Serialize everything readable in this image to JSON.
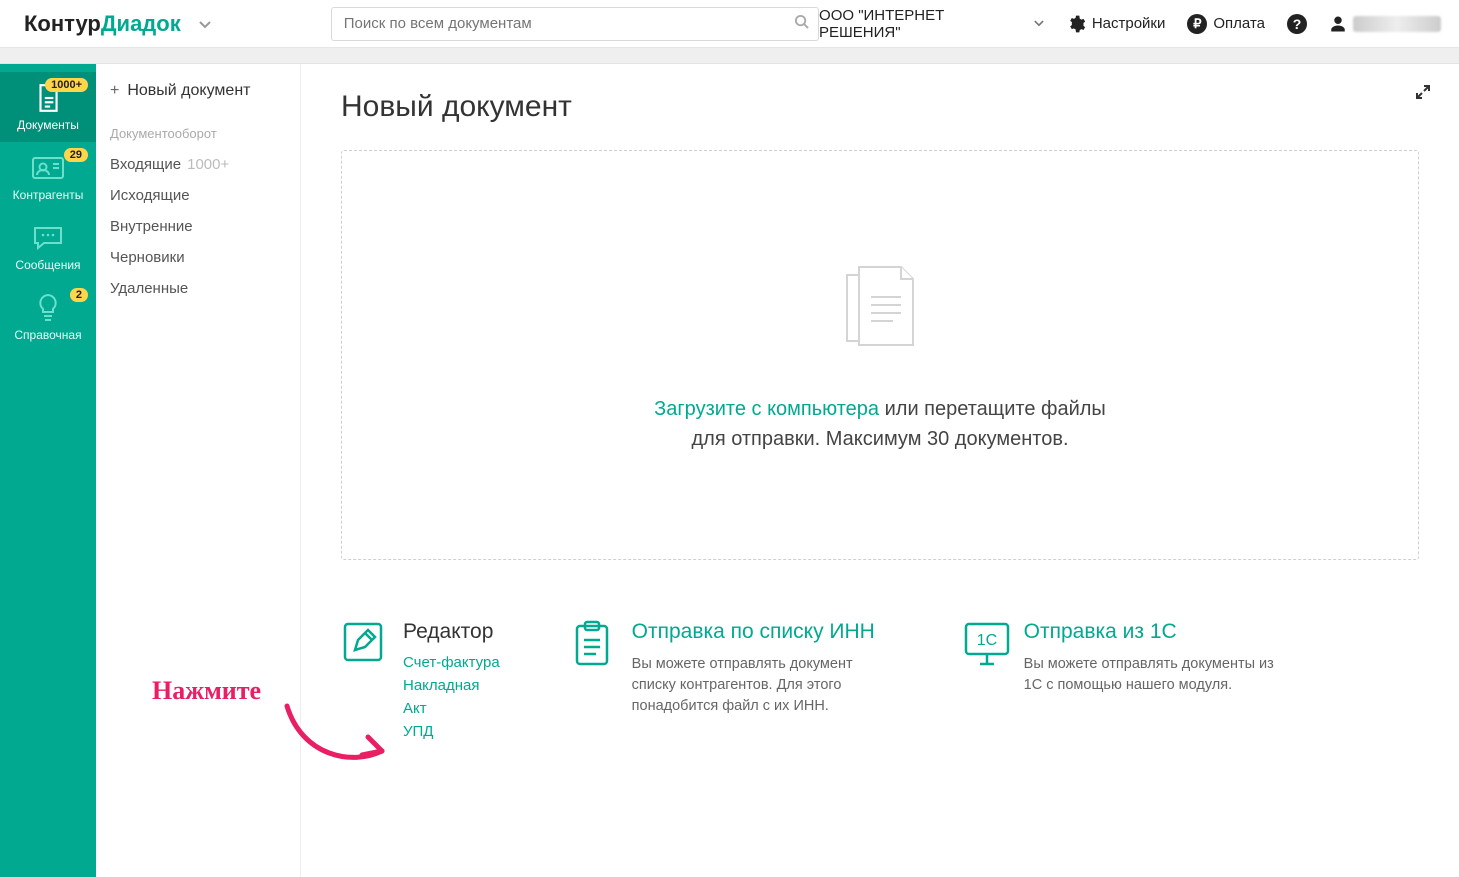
{
  "logo": {
    "part1": "Контур",
    "part2": "Диадок"
  },
  "search": {
    "placeholder": "Поиск по всем документам"
  },
  "top": {
    "org": "ООО \"ИНТЕРНЕТ РЕШЕНИЯ\"",
    "settings": "Настройки",
    "payment": "Оплата"
  },
  "sidebar": [
    {
      "key": "documents",
      "label": "Документы",
      "badge": "1000+",
      "active": true
    },
    {
      "key": "contragents",
      "label": "Контрагенты",
      "badge": "29",
      "active": false
    },
    {
      "key": "messages",
      "label": "Сообщения",
      "badge": null,
      "active": false
    },
    {
      "key": "reference",
      "label": "Справочная",
      "badge": "2",
      "active": false
    }
  ],
  "nav2": {
    "newDocument": "Новый документ",
    "groupTitle": "Документооборот",
    "items": [
      {
        "label": "Входящие",
        "count": "1000+"
      },
      {
        "label": "Исходящие",
        "count": null
      },
      {
        "label": "Внутренние",
        "count": null
      },
      {
        "label": "Черновики",
        "count": null
      },
      {
        "label": "Удаленные",
        "count": null
      }
    ]
  },
  "page": {
    "title": "Новый документ"
  },
  "dropzone": {
    "linkText": "Загрузите с компьютера",
    "afterLink": " или перетащите файлы",
    "line2": "для отправки. Максимум 30 документов."
  },
  "cards": {
    "editor": {
      "title": "Редактор",
      "links": [
        "Счет-фактура",
        "Накладная",
        "Акт",
        "УПД"
      ]
    },
    "inn": {
      "title": "Отправка по списку ИНН",
      "desc": "Вы можете отправлять документ списку контрагентов. Для этого понадобится файл с их ИНН."
    },
    "onec": {
      "title": "Отправка из 1С",
      "desc": "Вы можете отправлять документы из 1С с помощью нашего модуля.",
      "iconText": "1С"
    }
  },
  "annotation": {
    "text": "Нажмите"
  }
}
